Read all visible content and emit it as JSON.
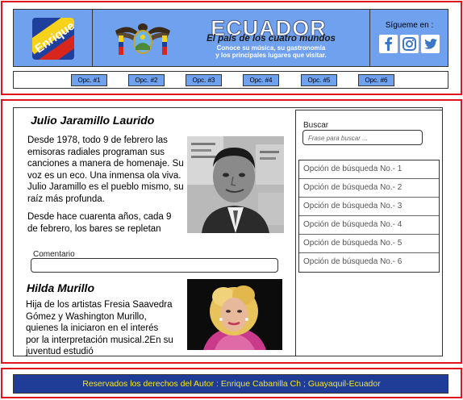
{
  "header": {
    "logo_text": "Enrique",
    "title": "ECUADOR",
    "subtitle": "El país de los cuatro mundos",
    "tagline_line1": "Conoce su música, su gastronomía",
    "tagline_line2": "y los principales lugares que visitar.",
    "follow_label": "Sígueme en :",
    "social_icons": [
      "facebook-icon",
      "instagram-icon",
      "twitter-icon"
    ]
  },
  "nav": {
    "items": [
      {
        "label": "Opc. #1"
      },
      {
        "label": "Opc. #2"
      },
      {
        "label": "Opc. #3"
      },
      {
        "label": "Opc. #4"
      },
      {
        "label": "Opc. #5"
      },
      {
        "label": "Opc. #6"
      }
    ]
  },
  "articles": [
    {
      "title": "Julio Jaramillo Laurido",
      "paragraph1": "Desde 1978, todo 9 de febrero las emisoras radiales programan sus canciones a manera de homenaje. Su voz es un eco. Una inmensa ola viva. Julio Jaramillo es el pueblo mismo, su raíz más profunda.",
      "paragraph2": "Desde hace cuarenta años, cada 9 de febrero, los bares se repletan"
    },
    {
      "title": "Hilda Murillo",
      "paragraph1": "Hija de los artistas Fresia Saavedra Gómez y Washington Murillo, quienes la iniciaron en el interés por la interpretación musical.2En su juventud estudió"
    }
  ],
  "comment": {
    "label": "Comentario",
    "value": ""
  },
  "search": {
    "label": "Buscar",
    "placeholder": "Frase para buscar ...",
    "options": [
      {
        "label": "Opción de búsqueda No.- 1"
      },
      {
        "label": "Opción de búsqueda No.- 2"
      },
      {
        "label": "Opción de búsqueda No.- 3"
      },
      {
        "label": "Opción de búsqueda No.- 4"
      },
      {
        "label": "Opción de búsqueda No.- 5"
      },
      {
        "label": "Opción de búsqueda No.- 6"
      }
    ]
  },
  "footer": {
    "text": "Reservados los derechos del Autor : Enrique Cabanilla Ch ; Guayaquil-Ecuador"
  },
  "colors": {
    "frame_red": "#e0141b",
    "banner_blue": "#6fa1ee",
    "footer_navy": "#1f3c97",
    "footer_text_yellow": "#f4e81a"
  }
}
